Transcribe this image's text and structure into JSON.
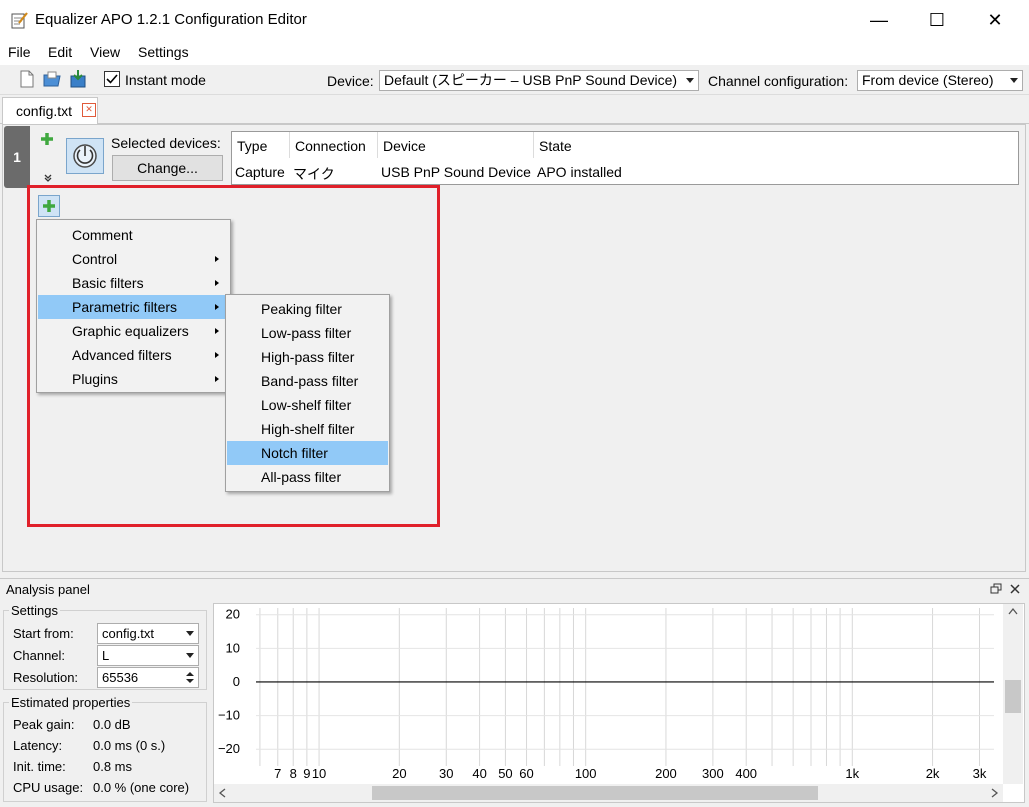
{
  "window": {
    "title": "Equalizer APO 1.2.1 Configuration Editor",
    "minimize": "—",
    "maximize": "☐",
    "close": "✕"
  },
  "menubar": [
    "File",
    "Edit",
    "View",
    "Settings"
  ],
  "toolbar": {
    "instant_mode_label": "Instant mode",
    "instant_mode_checked": true,
    "device_label": "Device:",
    "device_value": "Default (スピーカー – USB PnP Sound Device)",
    "channel_label": "Channel configuration:",
    "channel_value": "From device (Stereo)"
  },
  "tabs": [
    {
      "label": "config.txt",
      "close": "✕"
    }
  ],
  "filter_row": {
    "number": "1",
    "selected_devices_label": "Selected devices:",
    "change_button": "Change...",
    "table": {
      "headers": [
        "Type",
        "Connection",
        "Device",
        "State"
      ],
      "rows": [
        [
          "Capture",
          "マイク",
          "USB PnP Sound Device",
          "APO installed"
        ]
      ]
    }
  },
  "context_menu": {
    "items": [
      {
        "label": "Comment",
        "submenu": false
      },
      {
        "label": "Control",
        "submenu": true
      },
      {
        "label": "Basic filters",
        "submenu": true
      },
      {
        "label": "Parametric filters",
        "submenu": true,
        "selected": true
      },
      {
        "label": "Graphic equalizers",
        "submenu": true
      },
      {
        "label": "Advanced filters",
        "submenu": true
      },
      {
        "label": "Plugins",
        "submenu": true
      }
    ]
  },
  "submenu": {
    "items": [
      {
        "label": "Peaking filter"
      },
      {
        "label": "Low-pass filter"
      },
      {
        "label": "High-pass filter"
      },
      {
        "label": "Band-pass filter"
      },
      {
        "label": "Low-shelf filter"
      },
      {
        "label": "High-shelf filter"
      },
      {
        "label": "Notch filter",
        "selected": true
      },
      {
        "label": "All-pass filter"
      }
    ]
  },
  "analysis": {
    "title": "Analysis panel",
    "settings_title": "Settings",
    "start_from_label": "Start from:",
    "start_from_value": "config.txt",
    "channel_label": "Channel:",
    "channel_value": "L",
    "resolution_label": "Resolution:",
    "resolution_value": "65536",
    "estimated_title": "Estimated properties",
    "peak_gain_label": "Peak gain:",
    "peak_gain_value": "0.0 dB",
    "latency_label": "Latency:",
    "latency_value": "0.0 ms (0 s.)",
    "init_time_label": "Init. time:",
    "init_time_value": "0.8 ms",
    "cpu_label": "CPU usage:",
    "cpu_value": "0.0 % (one core)"
  },
  "chart_data": {
    "type": "line",
    "y_ticks": [
      "20",
      "10",
      "0",
      "−10",
      "−20"
    ],
    "y_values": [
      20,
      10,
      0,
      -10,
      -20
    ],
    "x_ticks": [
      "7",
      "8",
      "9",
      "10",
      "20",
      "30",
      "40",
      "50",
      "60",
      "100",
      "200",
      "300",
      "400",
      "1k",
      "2k",
      "3k"
    ],
    "x_values": [
      7,
      8,
      9,
      10,
      20,
      30,
      40,
      50,
      60,
      100,
      200,
      300,
      400,
      1000,
      2000,
      3000
    ],
    "x_scale": "log",
    "xlim": [
      5.8,
      3400
    ],
    "ylim": [
      -25,
      22
    ],
    "series": [
      {
        "x": [
          5.8,
          3400
        ],
        "y": [
          0,
          0
        ],
        "color": "#000000"
      }
    ],
    "grid": true
  }
}
